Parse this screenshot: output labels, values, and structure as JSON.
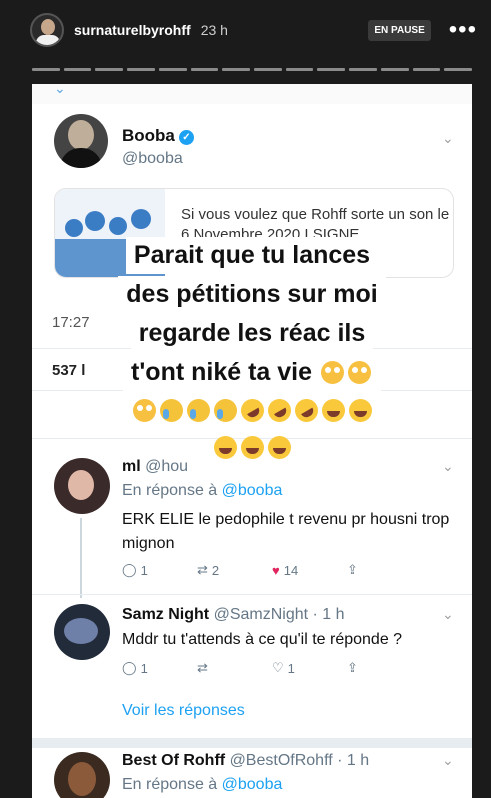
{
  "story": {
    "username": "surnaturelbyrohff",
    "time": "23 h",
    "pause_badge": "EN PAUSE",
    "more_icon": "more-dots-icon",
    "segments": 14
  },
  "tweet": {
    "author_name": "Booba",
    "author_handle": "@booba",
    "quote_text": "Si vous voulez que Rohff sorte un son le 6 Novembre 2020 I SIGNE...",
    "time_fragment": "17:27",
    "stats_fragment": "537 l"
  },
  "overlay_text": {
    "line1": "Parait que tu lances",
    "line2": "des pétitions sur moi",
    "line3": "regarde les réac ils",
    "line4": "t'ont niké ta vie"
  },
  "replies": [
    {
      "name": "ml",
      "handle": "@hou",
      "in_reply_label": "En réponse à",
      "in_reply_handle": "@booba",
      "text": "ERK ELIE le pedophile t revenu pr housni trop mignon",
      "replies": "1",
      "retweets": "2",
      "likes": "14"
    },
    {
      "name": "Samz Night",
      "handle": "@SamzNight · 1 h",
      "text": "Mddr tu t'attends à ce qu'il te réponde ?",
      "replies": "1",
      "retweets": "",
      "likes": "1"
    },
    {
      "name": "Best Of Rohff",
      "handle": "@BestOfRohff · 1 h",
      "in_reply_label": "En réponse à",
      "in_reply_handle": "@booba"
    }
  ],
  "see_replies": "Voir les réponses"
}
